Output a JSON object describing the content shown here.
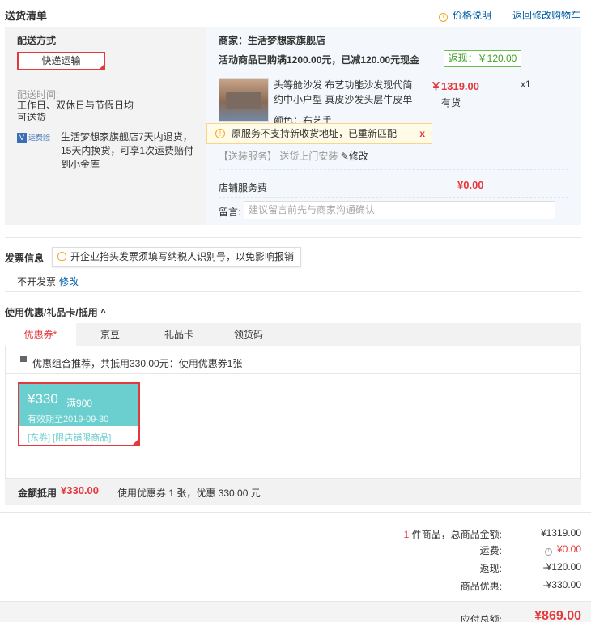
{
  "header": {
    "title": "送货清单",
    "price_explain": "价格说明",
    "back_cart": "返回修改购物车"
  },
  "shipping": {
    "label": "配送方式",
    "method": "快递运输",
    "time_label": "配送时间:",
    "time_value_1": "工作日、双休日与节假日均",
    "time_value_2": "可送货",
    "insurance_badge": "运费险",
    "note": "生活梦想家旗舰店7天内退货，15天内换货，可享1次运费赔付到小金库"
  },
  "shop": {
    "merchant": "商家：生活梦想家旗舰店",
    "promo": "活动商品已购满1200.00元，已减120.00元现金",
    "rebate_tag": "返现：￥120.00",
    "product": {
      "name": "头等舱沙发 布艺功能沙发现代简约中小户型 真皮沙发头层牛皮单",
      "price": "￥1319.00",
      "qty": "x1",
      "stock": "有货",
      "color": "颜色：布艺手"
    },
    "tip": "原服务不支持新收货地址，已重新匹配",
    "tip_close": "x",
    "install": "【送装服务】 送货上门安装",
    "install_edit": "修改",
    "service_fee_label": "店铺服务费",
    "service_fee": "¥0.00",
    "message_label": "留言:",
    "message_placeholder": "建议留言前先与商家沟通确认"
  },
  "invoice": {
    "title": "发票信息",
    "tip": "开企业抬头发票须填写纳税人识别号，以免影响报销",
    "value": "不开发票",
    "edit": "修改"
  },
  "coupon": {
    "title": "使用优惠/礼品卡/抵用 ^",
    "tabs": [
      "优惠券*",
      "京豆",
      "礼品卡",
      "领货码"
    ],
    "recommend": "优惠组合推荐，共抵用330.00元：使用优惠券1张",
    "card": {
      "amount": "¥330",
      "condition": "满900",
      "expiry": "有效期至2019-09-30",
      "tags": "[东券] [限店铺限商品]"
    },
    "sum_label": "金额抵用",
    "sum_value": "¥330.00",
    "sum_desc": "使用优惠券 1 张，优惠 330.00 元"
  },
  "totals": {
    "count_num": "1",
    "count_text": " 件商品，总商品金额:",
    "goods": "¥1319.00",
    "ship_label": "运费:",
    "ship": "¥0.00",
    "rebate_label": "返现:",
    "rebate": "-¥120.00",
    "discount_label": "商品优惠:",
    "discount": "-¥330.00",
    "pay_label": "应付总额:",
    "pay": "¥869.00"
  },
  "colors": {
    "accent": "#e4393c",
    "link": "#005ea7",
    "coupon": "#6ccfcf",
    "rebate_green": "#3fa12b"
  }
}
